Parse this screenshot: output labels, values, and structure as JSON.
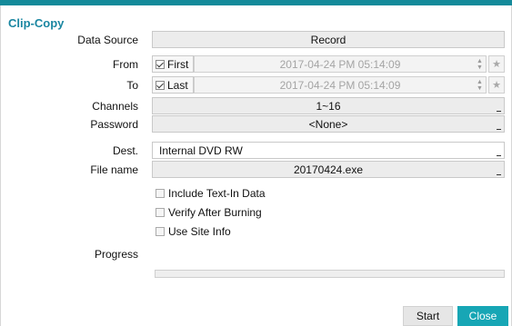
{
  "dialog": {
    "title": "Clip-Copy"
  },
  "form": {
    "data_source": {
      "label": "Data Source",
      "value": "Record"
    },
    "from": {
      "label": "From",
      "check_label": "First",
      "checked": true,
      "time": "2017-04-24  PM 05:14:09"
    },
    "to": {
      "label": "To",
      "check_label": "Last",
      "checked": true,
      "time": "2017-04-24  PM 05:14:09"
    },
    "channels": {
      "label": "Channels",
      "value": "1~16"
    },
    "password": {
      "label": "Password",
      "value": "<None>"
    },
    "dest": {
      "label": "Dest.",
      "value": "Internal DVD RW"
    },
    "file_name": {
      "label": "File name",
      "value": "20170424.exe"
    }
  },
  "options": [
    {
      "label": "Include Text-In Data",
      "checked": false
    },
    {
      "label": "Verify After Burning",
      "checked": false
    },
    {
      "label": "Use Site Info",
      "checked": false
    }
  ],
  "progress": {
    "label": "Progress",
    "value": 0
  },
  "buttons": {
    "start": "Start",
    "close": "Close"
  },
  "colors": {
    "accent": "#17a6b5",
    "title": "#1a86a1"
  },
  "icons": {
    "star": "star-icon",
    "spin": "spinner-arrows-icon"
  }
}
